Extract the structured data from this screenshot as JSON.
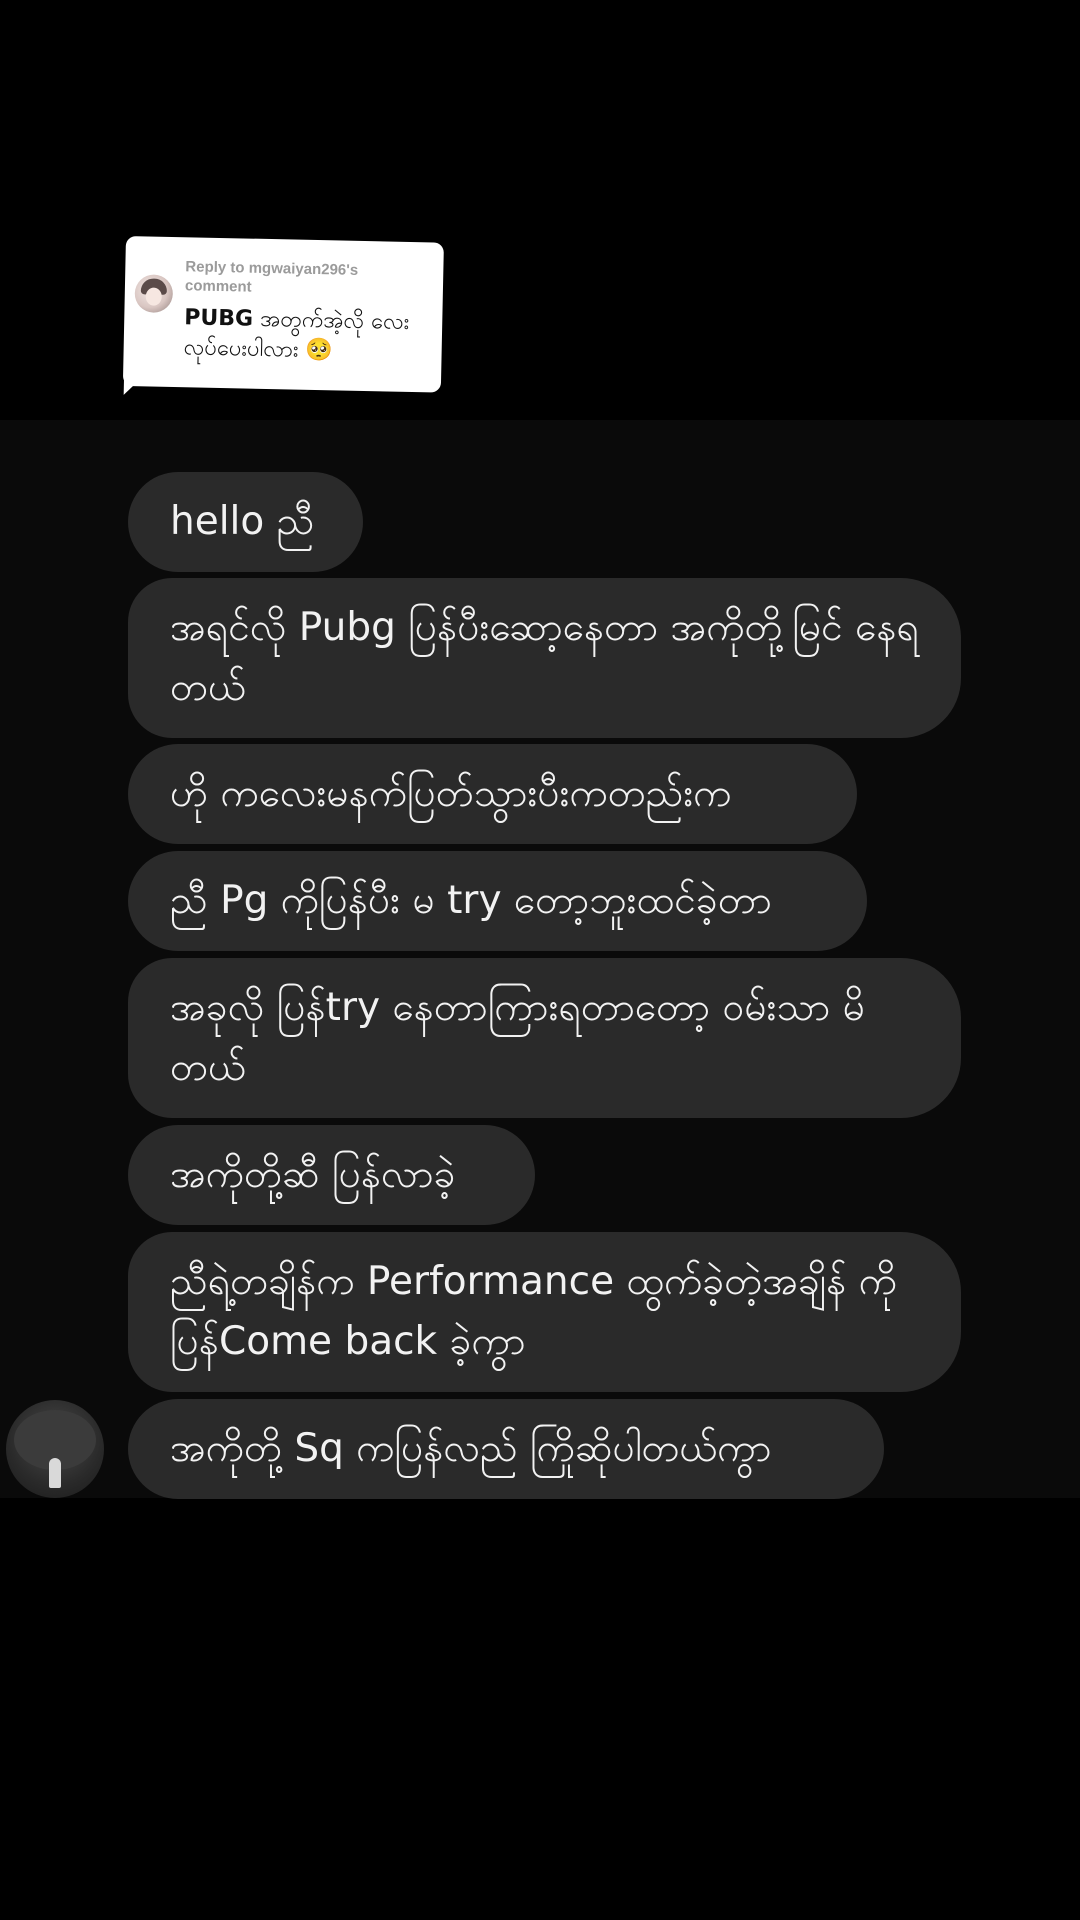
{
  "reply": {
    "reply_to": "Reply to mgwaiyan296's comment",
    "comment_bold": "PUBG",
    "comment_rest": " အတွက်အဲ့လို လေး လုပ်ပေးပါလား 🥺"
  },
  "messages": [
    "hello ညီ",
    "အရင်လို Pubg ပြန်ပီးဆော့နေတာ အကိုတို့မြင် နေရတယ်",
    "ဟို ကလေးမနက်ပြတ်သွားပီးကတည်းက",
    "ညီ Pg ကိုပြန်ပီး မ try တော့ဘူးထင်ခဲ့တာ",
    "အခုလို ပြန်try နေတာကြားရတာတော့ ဝမ်းသာ မိတယ်",
    "အကိုတို့ဆီ ပြန်လာခဲ့",
    "ညီရဲ့တချိန်က Performance ထွက်ခဲ့တဲ့အချိန် ကိုပြန်Come back ခဲ့ကွာ",
    "အကိုတို့ Sq ကပြန်လည် ကြိုဆိုပါတယ်ကွာ"
  ],
  "colors": {
    "background": "#000000",
    "panel": "#0a0a0a",
    "bubble": "#2a2a2a",
    "bubble_text": "#f2f2f2",
    "card": "#ffffff"
  }
}
